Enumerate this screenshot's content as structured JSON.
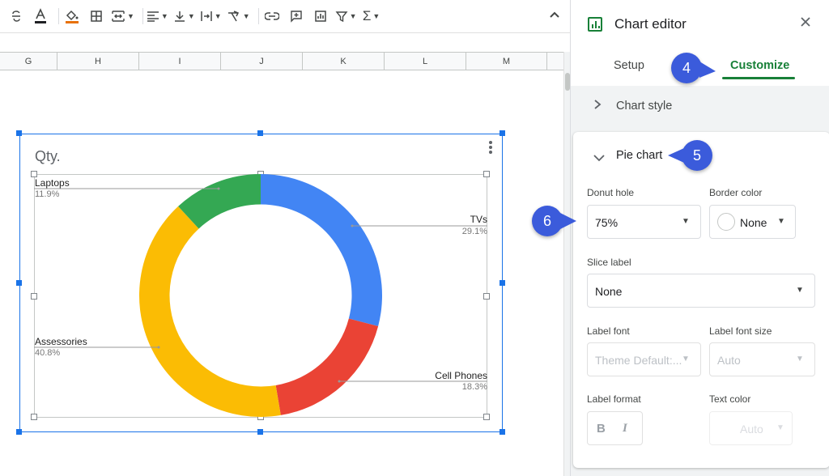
{
  "toolbar": {
    "icons": [
      "strikethrough-icon",
      "text-color-icon",
      "fill-color-icon",
      "borders-icon",
      "merge-cells-icon",
      "horizontal-align-icon",
      "vertical-align-icon",
      "text-wrap-icon",
      "text-rotation-icon",
      "insert-link-icon",
      "insert-comment-icon",
      "insert-chart-icon",
      "filter-icon",
      "functions-icon",
      "collapse-menu-icon"
    ]
  },
  "columns": [
    "G",
    "H",
    "I",
    "J",
    "K",
    "L",
    "M"
  ],
  "chart": {
    "title": "Qty.",
    "labels": {
      "laptops": {
        "name": "Laptops",
        "pct": "11.9%"
      },
      "tvs": {
        "name": "TVs",
        "pct": "29.1%"
      },
      "accessories": {
        "name": "Assessories",
        "pct": "40.8%"
      },
      "cell_phones": {
        "name": "Cell Phones",
        "pct": "18.3%"
      }
    }
  },
  "chart_data": {
    "type": "pie",
    "title": "Qty.",
    "donut_hole": 0.75,
    "categories": [
      "TVs",
      "Cell Phones",
      "Assessories",
      "Laptops"
    ],
    "values": [
      29.1,
      18.3,
      40.8,
      11.9
    ],
    "colors": [
      "#4285f4",
      "#ea4335",
      "#fbbc04",
      "#34a853"
    ],
    "legend": "labeled"
  },
  "panel": {
    "title": "Chart editor",
    "close_icon": "close-icon",
    "tabs": {
      "setup": "Setup",
      "customize": "Customize"
    },
    "chart_style": "Chart style",
    "pie_chart": "Pie chart",
    "donut_hole_label": "Donut hole",
    "donut_hole_value": "75%",
    "border_color_label": "Border color",
    "border_color_value": "None",
    "slice_label_label": "Slice label",
    "slice_label_value": "None",
    "label_font_label": "Label font",
    "label_font_value": "Theme Default:...",
    "label_font_size_label": "Label font size",
    "label_font_size_value": "Auto",
    "label_format_label": "Label format",
    "bold": "B",
    "italic": "I",
    "text_color_label": "Text color",
    "text_color_value": "Auto"
  },
  "callouts": {
    "c4": "4",
    "c5": "5",
    "c6": "6"
  },
  "colors": {
    "accent_green": "#188038",
    "selection_blue": "#1a73e8",
    "callout": "#3b5bdb"
  }
}
